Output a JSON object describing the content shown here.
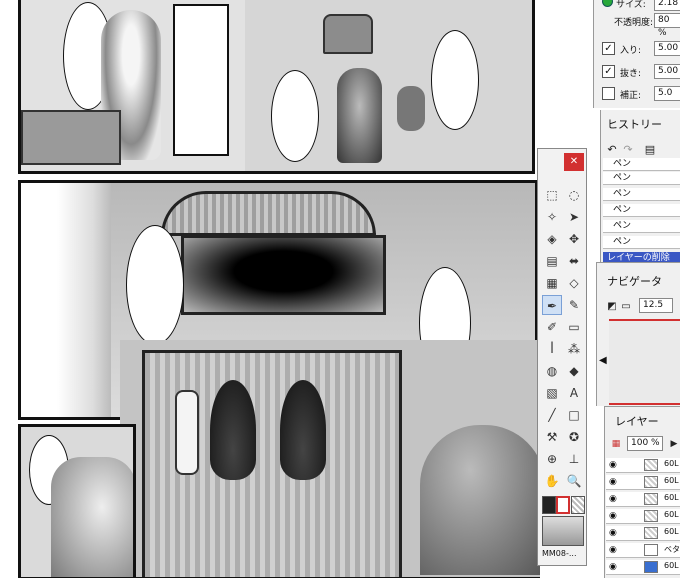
{
  "tool_properties": {
    "size_label": "サイズ:",
    "size_value": "2.18",
    "opacity_label": "不透明度:",
    "opacity_value": "80 %",
    "taper_in_label": "入り:",
    "taper_in_value": "5.00",
    "taper_out_label": "抜き:",
    "taper_out_value": "5.00",
    "correction_label": "補正:",
    "correction_value": "5.0"
  },
  "history": {
    "title": "ヒストリー",
    "items": [
      "ペン",
      "ペン",
      "ペン",
      "ペン",
      "ペン",
      "ペン",
      "ペン"
    ],
    "selected": "レイヤーの削除"
  },
  "navigator": {
    "title": "ナビゲータ",
    "zoom": "12.5"
  },
  "layers": {
    "title": "レイヤー",
    "opacity": "100 %",
    "items": [
      "60L",
      "60L",
      "60L",
      "60L",
      "60L",
      "60L",
      "ベタ",
      "60L"
    ]
  },
  "toolbox": {
    "close_label": "✕",
    "tone_name": "MM08-..."
  },
  "colors": {
    "accent_red": "#d23030",
    "selected_row": "#3a57c4",
    "tool_active": "#cfe0f5"
  }
}
